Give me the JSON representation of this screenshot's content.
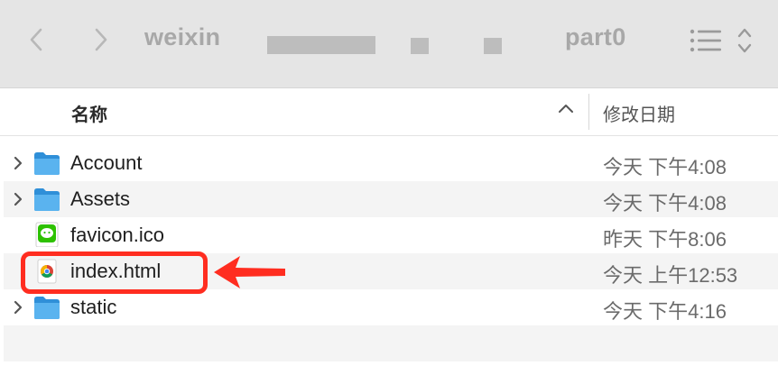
{
  "toolbar": {
    "back_icon": "chevron-left-icon",
    "forward_icon": "chevron-right-icon",
    "breadcrumb": [
      "weixin",
      "part0"
    ],
    "view_icon": "list-view-icon",
    "view_menu_icon": "chevron-updown-icon"
  },
  "columns": {
    "name": "名称",
    "date": "修改日期",
    "sort_icon": "chevron-up-icon"
  },
  "files": [
    {
      "name": "Account",
      "date": "今天 下午4:08",
      "icon": "folder-icon",
      "expandable": true
    },
    {
      "name": "Assets",
      "date": "今天 下午4:08",
      "icon": "folder-icon",
      "expandable": true
    },
    {
      "name": "favicon.ico",
      "date": "昨天 下午8:06",
      "icon": "wechat-icon",
      "expandable": false
    },
    {
      "name": "index.html",
      "date": "今天 上午12:53",
      "icon": "chrome-icon",
      "expandable": false
    },
    {
      "name": "static",
      "date": "今天 下午4:16",
      "icon": "folder-icon",
      "expandable": true
    }
  ],
  "annotation": {
    "color": "#ff2d20",
    "highlighted_file": "index.html"
  },
  "colors": {
    "folder": "#4aa8e8",
    "toolbar_bg": "#e5e5e5",
    "row_alt": "#f4f4f4"
  }
}
